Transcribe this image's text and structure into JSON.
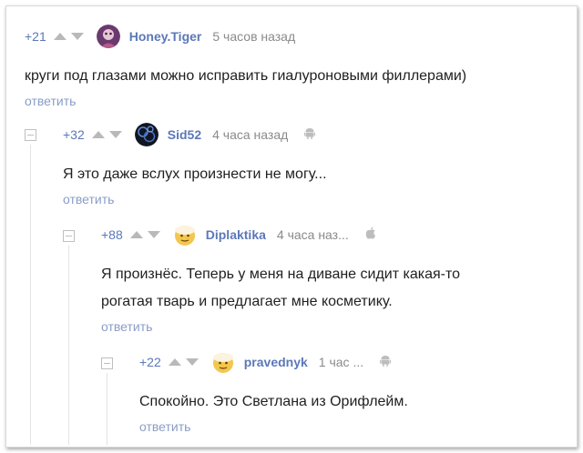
{
  "comments": [
    {
      "rating": "+21",
      "username": "Honey.Tiger",
      "time": "5 часов назад",
      "lines": [
        "круги под глазами можно исправить гиалуроновыми филлерами)"
      ],
      "reply": "ответить",
      "platform": "",
      "avatar_icon": "purple-avatar"
    },
    {
      "rating": "+32",
      "username": "Sid52",
      "time": "4 часа назад",
      "lines": [
        "Я это даже вслух произнести не могу..."
      ],
      "reply": "ответить",
      "platform": "android",
      "avatar_icon": "dark-blue-bubbles-avatar"
    },
    {
      "rating": "+88",
      "username": "Diplaktika",
      "time": "4 часа наз...",
      "lines": [
        "Я произнёс. Теперь у меня на диване сидит какая-то",
        "рогатая тварь и предлагает мне косметику."
      ],
      "reply": "ответить",
      "platform": "apple",
      "avatar_icon": "yellow-emoji-avatar"
    },
    {
      "rating": "+22",
      "username": "pravednyk",
      "time": "1 час ...",
      "lines": [
        "Спокойно. Это Светлана из Орифлейм."
      ],
      "reply": "ответить",
      "platform": "android",
      "avatar_icon": "yellow-emoji-avatar"
    }
  ],
  "colors": {
    "link": "#5b78b8",
    "reply": "#8a9cc7",
    "muted": "#8a8a8a",
    "arrows": "#b9b9b9"
  }
}
